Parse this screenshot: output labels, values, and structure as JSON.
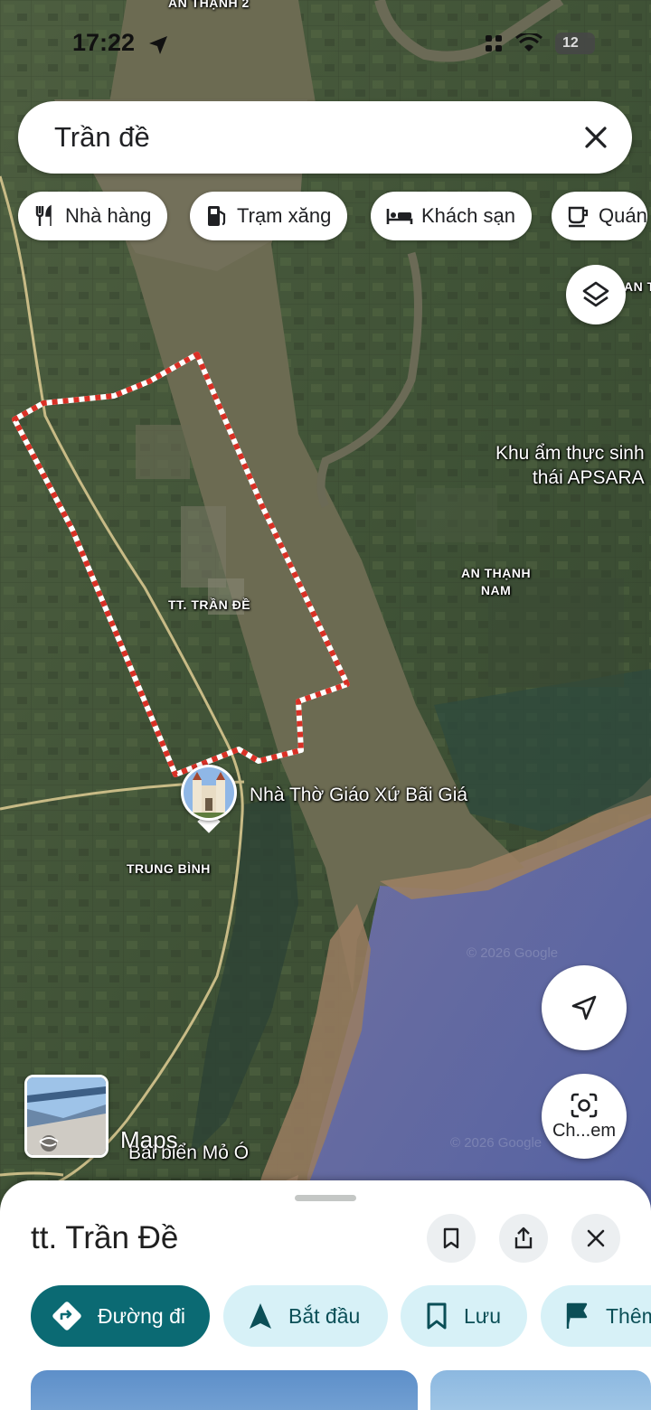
{
  "status_bar": {
    "time": "17:22",
    "battery": "12"
  },
  "search": {
    "query": "Trần đề"
  },
  "chips": [
    {
      "label": "Nhà hàng",
      "icon": "restaurant-icon"
    },
    {
      "label": "Trạm xăng",
      "icon": "gas-station-icon"
    },
    {
      "label": "Khách sạn",
      "icon": "hotel-icon"
    },
    {
      "label": "Quán",
      "icon": "coffee-icon"
    }
  ],
  "map": {
    "top_label": "AN THẠNH 2",
    "edge_label": "AN T",
    "labels": {
      "tran_de": "TT. TRẦN ĐỀ",
      "an_thanh_nam": "AN THẠNH\nNAM",
      "trung_binh": "TRUNG BÌNH",
      "khu_am_thuc": "Khu ẩm thực sinh\nthái APSARA",
      "church": "Nhà Thờ Giáo Xứ Bãi Giá",
      "beach": "Bãi biển Mỏ Ó"
    },
    "watermark": "© 2026 Google",
    "logo": "Maps"
  },
  "lens_button": {
    "label": "Ch...em"
  },
  "place": {
    "title": "tt. Trần Đề",
    "actions": [
      {
        "label": "Đường đi",
        "icon": "directions-icon"
      },
      {
        "label": "Bắt đầu",
        "icon": "navigation-arrow-icon"
      },
      {
        "label": "Lưu",
        "icon": "bookmark-icon"
      },
      {
        "label": "Thêm",
        "icon": "flag-icon"
      }
    ]
  },
  "colors": {
    "primary": "#0b6a73",
    "secondary_bg": "#d7f1f7",
    "boundary_red": "#d93025",
    "water": "#5866a6",
    "river": "#6d6c54"
  }
}
